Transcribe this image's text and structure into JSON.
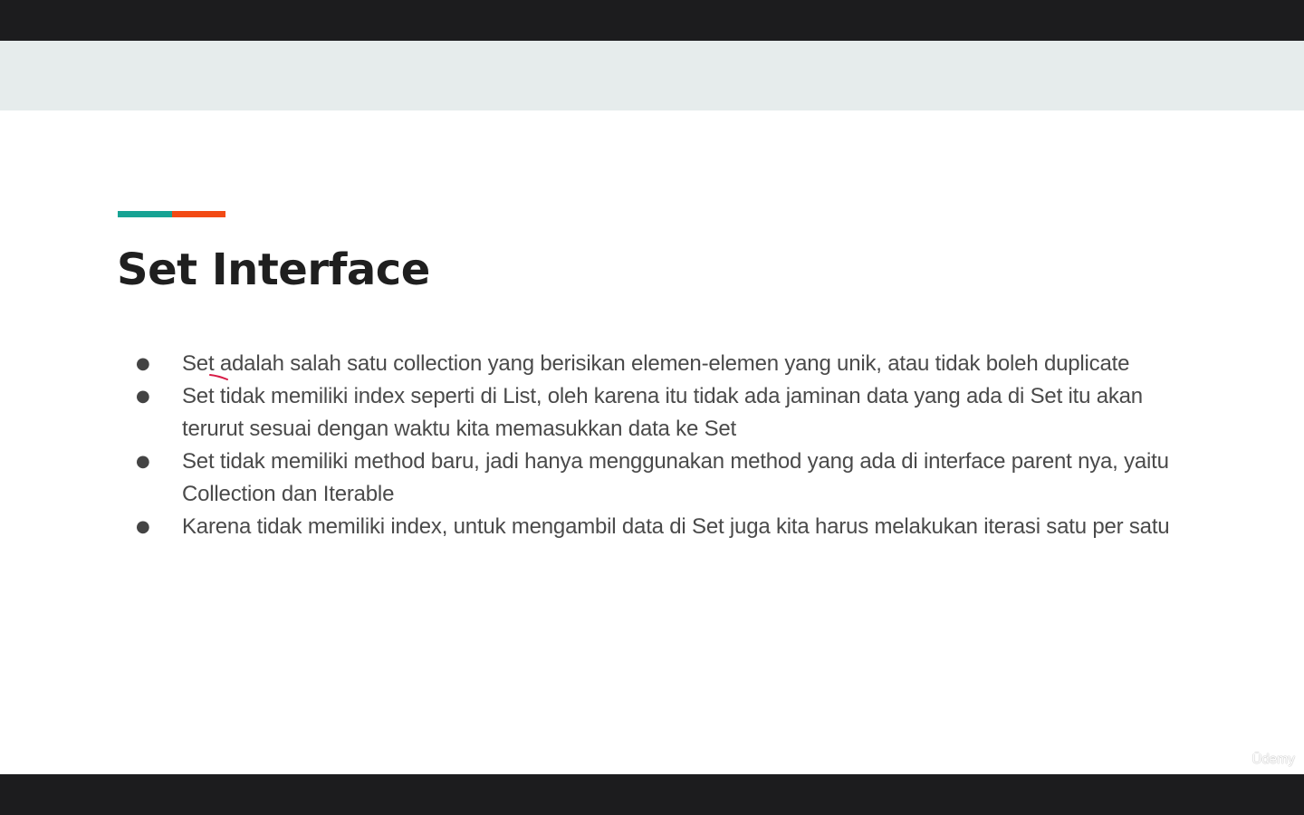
{
  "slide": {
    "title": "Set Interface",
    "accent_colors": [
      "#17a394",
      "#f24a14"
    ],
    "bullets": [
      "Set adalah salah satu collection yang berisikan elemen-elemen yang unik, atau tidak boleh duplicate",
      "Set tidak memiliki index seperti di List, oleh karena itu tidak ada jaminan data yang ada di Set itu akan terurut sesuai dengan waktu kita memasukkan data ke Set",
      "Set tidak memiliki method baru, jadi hanya menggunakan method yang ada di interface parent nya, yaitu Collection dan Iterable",
      "Karena tidak memiliki index, untuk mengambil data di Set juga kita harus melakukan iterasi satu per satu"
    ],
    "bullet_symbol": "●"
  },
  "watermark": "Ūdemy",
  "colors": {
    "letterbox": "#1c1c1e",
    "header_band": "#e6ecec",
    "title_text": "#1f1f1f",
    "body_text": "#4a4a4a",
    "pen_mark": "#d81b46"
  }
}
